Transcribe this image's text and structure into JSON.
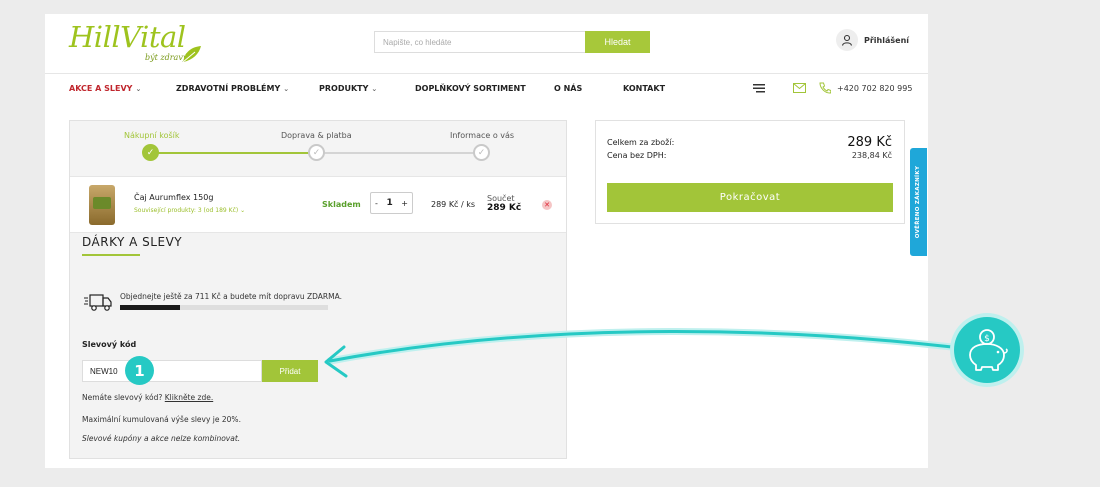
{
  "header": {
    "logo_brand": "HillVital",
    "logo_tagline": "být zdravý",
    "search_placeholder": "Napište, co hledáte",
    "search_button": "Hledat",
    "login_label": "Přihlášení"
  },
  "nav": {
    "items": [
      {
        "label": "AKCE A SLEVY",
        "dropdown": true,
        "highlight": true
      },
      {
        "label": "ZDRAVOTNÍ PROBLÉMY",
        "dropdown": true
      },
      {
        "label": "PRODUKTY",
        "dropdown": true
      },
      {
        "label": "DOPLŇKOVÝ SORTIMENT",
        "dropdown": false
      },
      {
        "label": "O NÁS",
        "dropdown": false
      },
      {
        "label": "KONTAKT",
        "dropdown": false
      }
    ],
    "phone": "+420 702 820 995"
  },
  "steps": [
    {
      "label": "Nákupní košík",
      "state": "done"
    },
    {
      "label": "Doprava & platba",
      "state": "pending"
    },
    {
      "label": "Informace o vás",
      "state": "pending"
    }
  ],
  "cart_item": {
    "name": "Čaj Aurumflex 150g",
    "related": "Související produkty: 3 (od 189 Kč)",
    "availability": "Skladem",
    "quantity": "1",
    "unit_price": "289 Kč / ks",
    "sum_label": "Součet",
    "sum_value": "289 Kč"
  },
  "gifts": {
    "title": "DÁRKY A SLEVY",
    "shipping_message": "Objednejte ještě za 711 Kč a budete mít dopravu ZDARMA.",
    "shipping_progress": 0.29,
    "code_label": "Slevový kód",
    "code_value": "NEW10",
    "code_button": "Přidat",
    "step_badge": "1",
    "no_code_text": "Nemáte slevový kód?",
    "no_code_link": "Klikněte zde.",
    "max_discount": "Maximální kumulovaná výše slevy je 20%.",
    "combine_note": "Slevové kupóny a akce nelze kombinovat."
  },
  "summary": {
    "total_label": "Celkem za zboží:",
    "total_value": "289 Kč",
    "net_label": "Cena bez DPH:",
    "net_value": "238,84 Kč",
    "continue_button": "Pokračovat"
  },
  "verified_tab": "OVĚŘENO ZÁKAZNÍKY",
  "colors": {
    "accent": "#a2c539",
    "teal": "#26c9c4",
    "red": "#c0262d",
    "blue": "#1fa7d9"
  }
}
